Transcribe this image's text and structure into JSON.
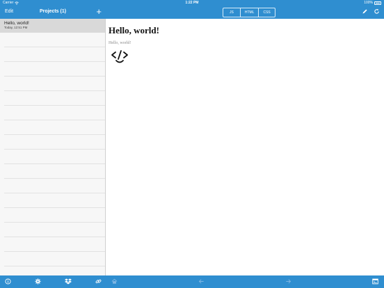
{
  "status": {
    "carrier": "Carrier",
    "time": "1:22 PM",
    "battery": "100%"
  },
  "navbar": {
    "edit_label": "Edit",
    "title": "Projects (1)",
    "add_label": "+",
    "segments": [
      "JS",
      "HTML",
      "CSS"
    ],
    "icons": [
      "pencil-icon",
      "refresh-icon"
    ]
  },
  "sidebar": {
    "projects": [
      {
        "title": "Hello, world!",
        "date": "Today, 12:51 PM"
      }
    ]
  },
  "preview": {
    "heading": "Hello, world!",
    "subtext": "Hello, world!",
    "logo_text": "</>"
  },
  "bottombar": {
    "icons": [
      "info-icon",
      "gear-icon",
      "dropbox-icon",
      "link-icon",
      "home-icon",
      "back-arrow-icon",
      "forward-arrow-icon",
      "console-icon"
    ]
  },
  "colors": {
    "accent": "#2f8ed0",
    "selected_row": "#d9d9d9",
    "sidebar_bg": "#f7f7f7"
  }
}
